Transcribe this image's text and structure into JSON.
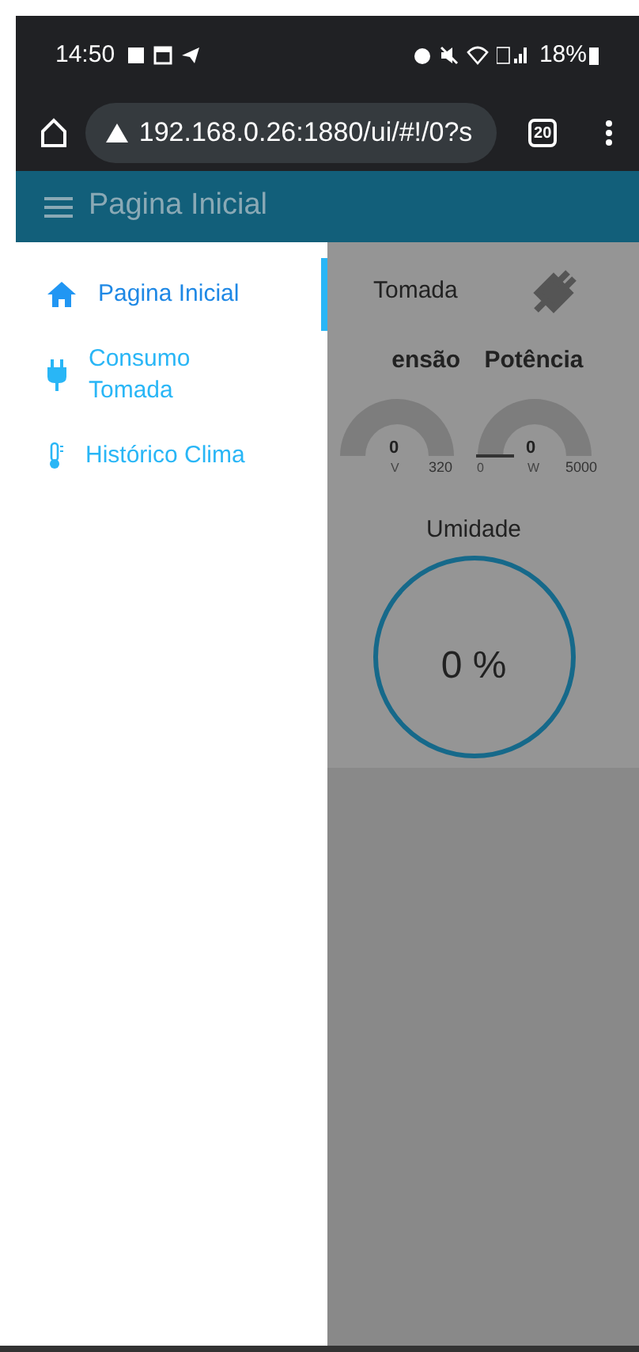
{
  "status_bar": {
    "time": "14:50",
    "battery": "18%"
  },
  "browser": {
    "url": "192.168.0.26:1880/ui/#!/0?s",
    "tab_count": "20"
  },
  "header": {
    "title": "Pagina Inicial"
  },
  "drawer": {
    "items": [
      {
        "label": "Pagina Inicial",
        "kind": "home",
        "selected": true
      },
      {
        "label": "Consumo Tomada",
        "kind": "plug",
        "selected": false
      },
      {
        "label": "Histórico Clima",
        "kind": "thermometer",
        "selected": false
      }
    ]
  },
  "content": {
    "card_title": "Tomada",
    "gauges": [
      {
        "label": "ensão",
        "value": "0",
        "unit": "V",
        "max": "320"
      },
      {
        "label": "Potência",
        "value": "0",
        "unit": "W",
        "min": "0",
        "max": "5000"
      }
    ],
    "humidity": {
      "label": "Umidade",
      "value": "0 %"
    }
  }
}
